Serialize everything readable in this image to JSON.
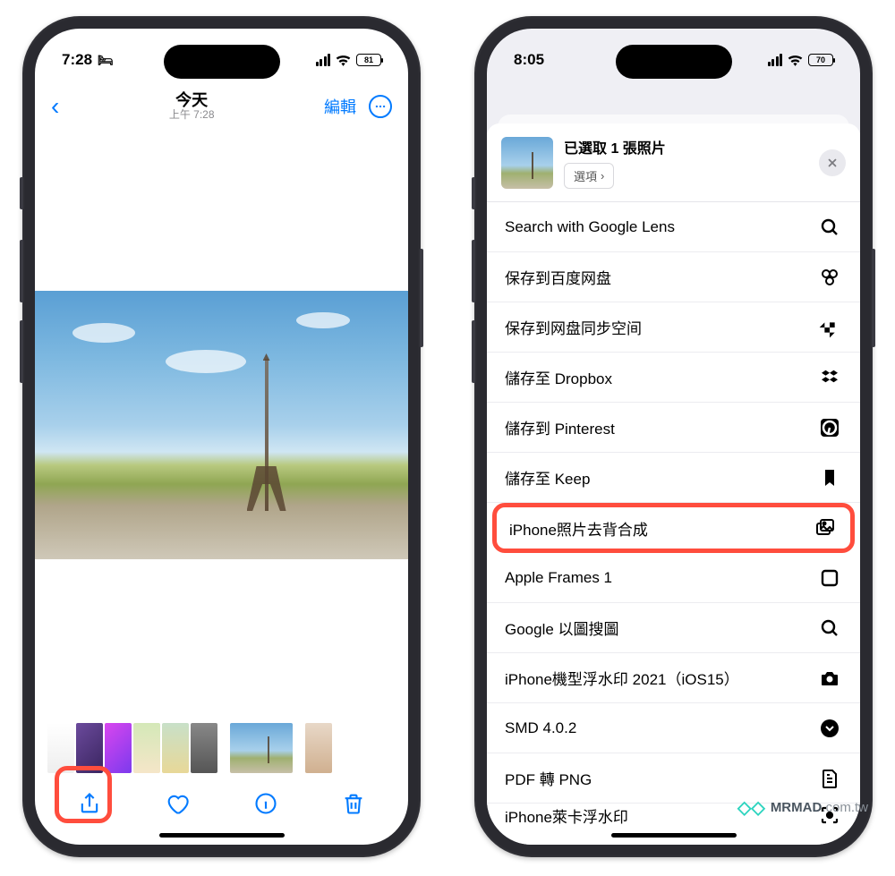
{
  "left": {
    "status": {
      "time": "7:28",
      "battery": "81"
    },
    "nav": {
      "title": "今天",
      "subtitle": "上午 7:28",
      "edit": "編輯"
    }
  },
  "right": {
    "status": {
      "time": "8:05",
      "battery": "70"
    },
    "sheet": {
      "title": "已選取 1 張照片",
      "options": "選項"
    },
    "actions": {
      "a0": "Search with Google Lens",
      "a1": "保存到百度网盘",
      "a2": "保存到网盘同步空间",
      "a3": "儲存至 Dropbox",
      "a4": "儲存到 Pinterest",
      "a5": "儲存至 Keep",
      "a6": "iPhone照片去背合成",
      "a7": "Apple Frames 1",
      "a8": "Google 以圖搜圖",
      "a9": "iPhone機型浮水印 2021（iOS15）",
      "a10": "SMD 4.0.2",
      "a11": "PDF 轉 PNG",
      "a12": "iPhone萊卡浮水印"
    }
  },
  "watermark": {
    "brand": "MRMAD",
    "domain": ".com.tw"
  }
}
